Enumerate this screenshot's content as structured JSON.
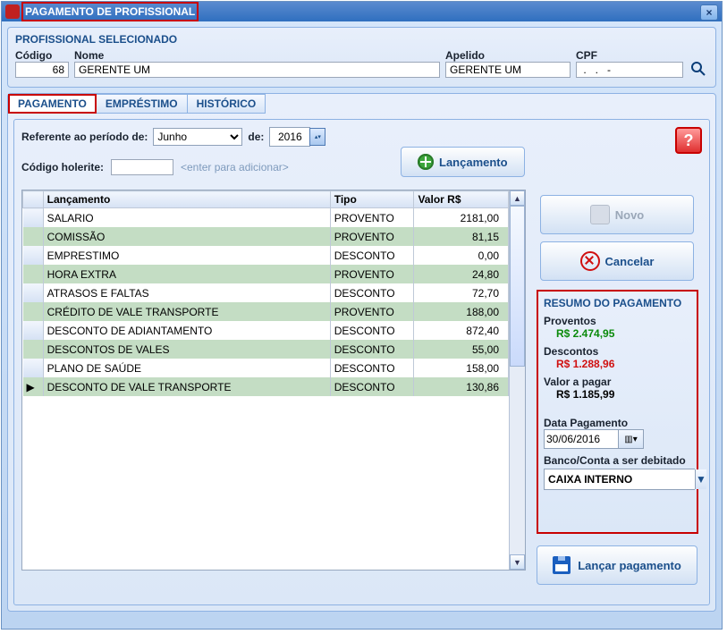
{
  "window": {
    "title": "PAGAMENTO DE PROFISSIONAL"
  },
  "prof": {
    "heading": "PROFISSIONAL SELECIONADO",
    "labels": {
      "codigo": "Código",
      "nome": "Nome",
      "apelido": "Apelido",
      "cpf": "CPF"
    },
    "values": {
      "codigo": "68",
      "nome": "GERENTE UM",
      "apelido": "GERENTE UM",
      "cpf": " .   .   -"
    }
  },
  "tabs": {
    "pagamento": "PAGAMENTO",
    "emprestimo": "EMPRÉSTIMO",
    "historico": "HISTÓRICO"
  },
  "periodo": {
    "label": "Referente ao período de:",
    "mes": "Junho",
    "de": "de:",
    "ano": "2016"
  },
  "holerite": {
    "label": "Código holerite:",
    "value": "",
    "placeholder": "<enter para adicionar>"
  },
  "buttons": {
    "lancamento": "Lançamento",
    "novo": "Novo",
    "cancelar": "Cancelar",
    "lancar_pagamento": "Lançar pagamento"
  },
  "grid": {
    "headers": {
      "lancamento": "Lançamento",
      "tipo": "Tipo",
      "valor": "Valor R$"
    },
    "rows": [
      {
        "lanc": "SALARIO",
        "tipo": "PROVENTO",
        "valor": "2181,00",
        "marker": ""
      },
      {
        "lanc": "COMISSÃO",
        "tipo": "PROVENTO",
        "valor": "81,15",
        "marker": ""
      },
      {
        "lanc": "EMPRESTIMO",
        "tipo": "DESCONTO",
        "valor": "0,00",
        "marker": ""
      },
      {
        "lanc": "HORA EXTRA",
        "tipo": "PROVENTO",
        "valor": "24,80",
        "marker": ""
      },
      {
        "lanc": "ATRASOS E FALTAS",
        "tipo": "DESCONTO",
        "valor": "72,70",
        "marker": ""
      },
      {
        "lanc": "CRÉDITO DE VALE TRANSPORTE",
        "tipo": "PROVENTO",
        "valor": "188,00",
        "marker": ""
      },
      {
        "lanc": "DESCONTO DE ADIANTAMENTO",
        "tipo": "DESCONTO",
        "valor": "872,40",
        "marker": ""
      },
      {
        "lanc": "DESCONTOS DE VALES",
        "tipo": "DESCONTO",
        "valor": "55,00",
        "marker": ""
      },
      {
        "lanc": "PLANO DE SAÚDE",
        "tipo": "DESCONTO",
        "valor": "158,00",
        "marker": ""
      },
      {
        "lanc": "DESCONTO DE VALE TRANSPORTE",
        "tipo": "DESCONTO",
        "valor": "130,86",
        "marker": "▶"
      }
    ]
  },
  "resumo": {
    "heading": "RESUMO DO PAGAMENTO",
    "proventos_lbl": "Proventos",
    "proventos_val": "R$ 2.474,95",
    "descontos_lbl": "Descontos",
    "descontos_val": "R$ 1.288,96",
    "valor_lbl": "Valor a pagar",
    "valor_val": "R$ 1.185,99",
    "data_lbl": "Data Pagamento",
    "data_val": "30/06/2016",
    "banco_lbl": "Banco/Conta a ser debitado",
    "banco_val": "CAIXA INTERNO"
  }
}
